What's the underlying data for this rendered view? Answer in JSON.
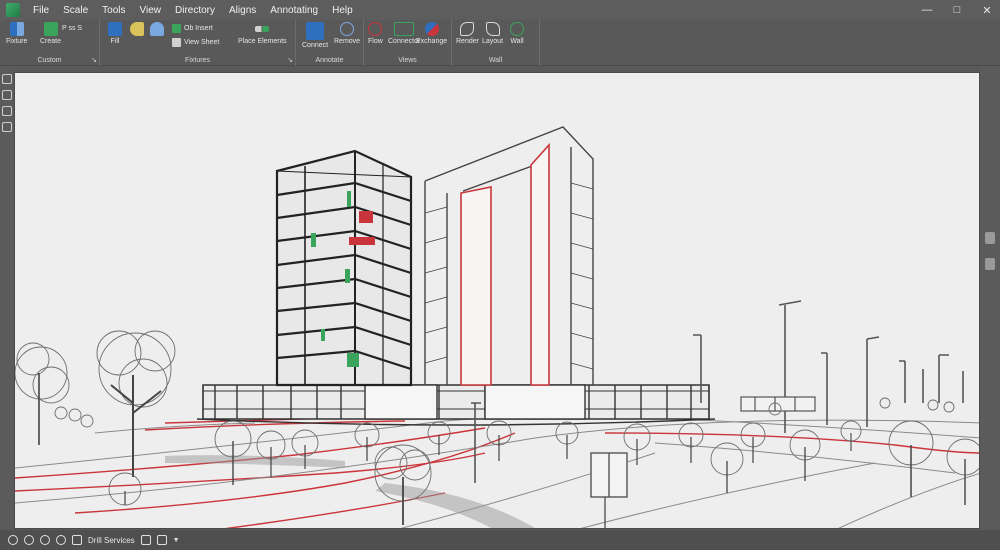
{
  "menubar": {
    "items": [
      "File",
      "Scale",
      "Tools",
      "View",
      "Directory",
      "Aligns",
      "Annotating",
      "Help"
    ]
  },
  "ribbon": {
    "groups": [
      {
        "label": "Custom",
        "buttons": [
          "Fixture",
          "Create"
        ]
      },
      {
        "label": "Fixtures",
        "buttons": [
          "Fill",
          "Ob Insert",
          "View Sheet",
          "Place Elements"
        ]
      },
      {
        "label": "Annotate",
        "buttons": [
          "Connect",
          "Remove"
        ]
      },
      {
        "label": "Views",
        "buttons": [
          "Flow",
          "Connector",
          "Exchange"
        ]
      },
      {
        "label": "Wall",
        "buttons": [
          "Render",
          "Layout",
          "Wall"
        ]
      }
    ],
    "group1_extra": "P ss S"
  },
  "statusbar": {
    "text": "Drill Services"
  },
  "colors": {
    "accent_red": "#c9353a",
    "accent_green": "#3aa35c",
    "accent_blue": "#2f6fc0",
    "canvas_bg": "#efeeef"
  }
}
